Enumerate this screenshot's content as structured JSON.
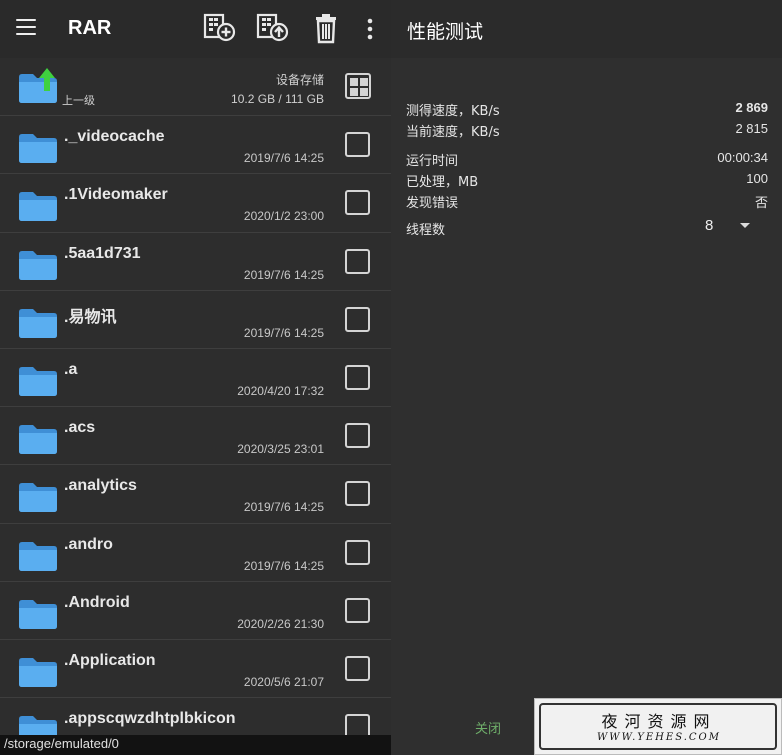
{
  "app_bar": {
    "title": "RAR",
    "icons": [
      "menu-icon",
      "add-to-archive-icon",
      "extract-archive-icon",
      "delete-icon",
      "more-vert-icon"
    ]
  },
  "parent_row": {
    "label": "上一级",
    "storage_label": "设备存储",
    "storage_size": "10.2 GB / 111 GB",
    "icon": "folder-up-icon"
  },
  "files": [
    {
      "name": "._videocache",
      "date": "2019/7/6 14:25"
    },
    {
      "name": ".1Videomaker",
      "date": "2020/1/2 23:00"
    },
    {
      "name": ".5aa1d731",
      "date": "2019/7/6 14:25"
    },
    {
      "name": ".易物讯",
      "date": "2019/7/6 14:25"
    },
    {
      "name": ".a",
      "date": "2020/4/20 17:32"
    },
    {
      "name": ".acs",
      "date": "2020/3/25 23:01"
    },
    {
      "name": ".analytics",
      "date": "2019/7/6 14:25"
    },
    {
      "name": ".andro",
      "date": "2019/7/6 14:25"
    },
    {
      "name": ".Android",
      "date": "2020/2/26 21:30"
    },
    {
      "name": ".Application",
      "date": "2020/5/6 21:07"
    },
    {
      "name": ".appscqwzdhtplbkicon",
      "date": ""
    }
  ],
  "path": "/storage/emulated/0",
  "benchmark": {
    "title": "性能测试",
    "measured_speed_label": "测得速度，KB/s",
    "measured_speed_value": "2 869",
    "current_speed_label": "当前速度，KB/s",
    "current_speed_value": "2 815",
    "run_time_label": "运行时间",
    "run_time_value": "00:00:34",
    "processed_label": "已处理，MB",
    "processed_value": "100",
    "errors_label": "发现错误",
    "errors_value": "否",
    "threads_label": "线程数",
    "threads_value": "8",
    "close_label": "关闭"
  },
  "watermark": {
    "main": "夜河资源网",
    "sub": "WWW.YEHES.COM"
  },
  "colors": {
    "folder": "#5aaef0",
    "folder_tab": "#3f8fd6",
    "up_arrow": "#3fd13f",
    "close_text": "#6fae6a"
  }
}
